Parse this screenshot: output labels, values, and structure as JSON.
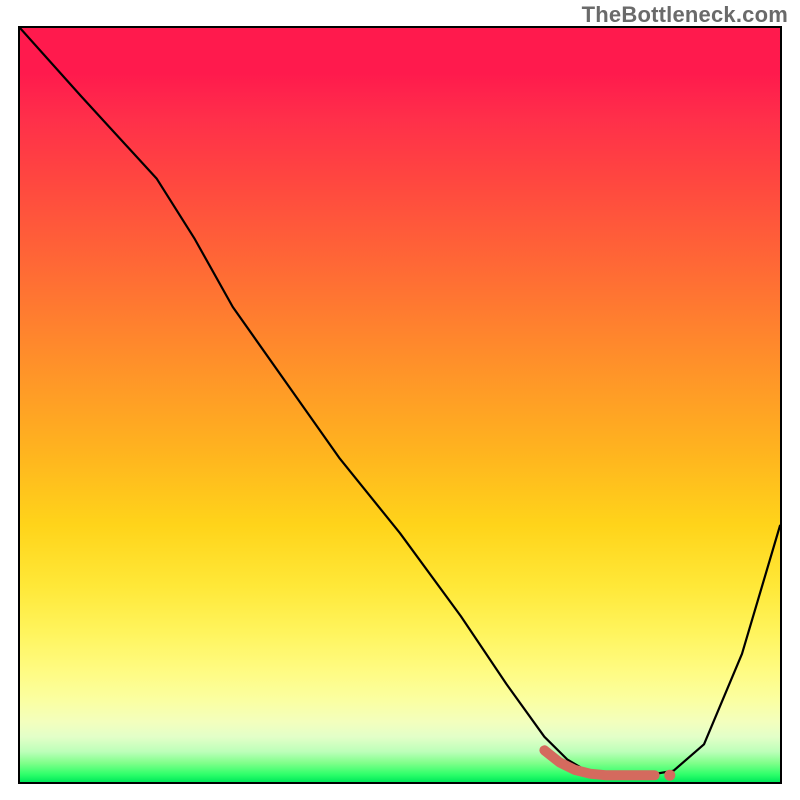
{
  "watermark": "TheBottleneck.com",
  "chart_data": {
    "type": "line",
    "title": "",
    "xlabel": "",
    "ylabel": "",
    "xlim": [
      0,
      100
    ],
    "ylim": [
      0,
      100
    ],
    "grid": false,
    "legend": false,
    "x": [
      0,
      8,
      18,
      23,
      28,
      35,
      42,
      50,
      58,
      64,
      69,
      72,
      75,
      78,
      82,
      86,
      90,
      95,
      100
    ],
    "values": [
      100,
      91,
      80,
      72,
      63,
      53,
      43,
      33,
      22,
      13,
      6,
      3,
      1.2,
      0.8,
      0.8,
      1.5,
      5,
      17,
      34
    ],
    "accent_segment": {
      "x": [
        69,
        71,
        73,
        75,
        77,
        79,
        81,
        82.5,
        83.5
      ],
      "values": [
        4.2,
        2.6,
        1.6,
        1.1,
        0.9,
        0.9,
        0.9,
        0.9,
        0.9
      ]
    },
    "accent_dot": {
      "x": 85.5,
      "y": 0.9
    },
    "gradient_stops": [
      {
        "pos": 0.0,
        "color": "#ff1a4d"
      },
      {
        "pos": 0.55,
        "color": "#ffd41a"
      },
      {
        "pos": 0.85,
        "color": "#fffb80"
      },
      {
        "pos": 1.0,
        "color": "#00e85a"
      }
    ],
    "colors": {
      "curve": "#000000",
      "accent": "#d46a5e"
    }
  }
}
